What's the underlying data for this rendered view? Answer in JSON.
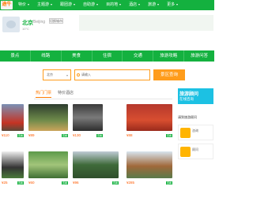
{
  "nav": {
    "brand": "途牛网",
    "items": [
      "特价",
      "主题游",
      "跟团游",
      "自助游",
      "目的地",
      "酒店",
      "旅游",
      "更多"
    ]
  },
  "header": {
    "city": "北京",
    "city_pinyin": "Beijing",
    "switch_label": "切换城市",
    "weather": "10°C"
  },
  "tabs": [
    "景点",
    "线路",
    "美食",
    "住宿",
    "交通",
    "旅游攻略",
    "旅游问答"
  ],
  "search": {
    "select_label": "北京",
    "placeholder": "请输入",
    "button_label": "景区查询"
  },
  "subtabs": [
    "热门门票",
    "特价酒店"
  ],
  "cards": [
    {
      "price": "¥110",
      "tag": "查看"
    },
    {
      "price": "¥89",
      "tag": "查看"
    },
    {
      "price": "¥130",
      "tag": "查看"
    },
    {
      "price": "¥88",
      "tag": "查看"
    },
    {
      "price": "¥25",
      "tag": "查看"
    },
    {
      "price": "¥60",
      "tag": "查看"
    },
    {
      "price": "¥96",
      "tag": "查看"
    },
    {
      "price": "¥285",
      "tag": "查看"
    }
  ],
  "sidebar": {
    "banner_big": "旅游顾问",
    "banner_small": "在线咨询",
    "link": "请到旅游顾问",
    "items": [
      "咨询",
      "顾问"
    ]
  }
}
